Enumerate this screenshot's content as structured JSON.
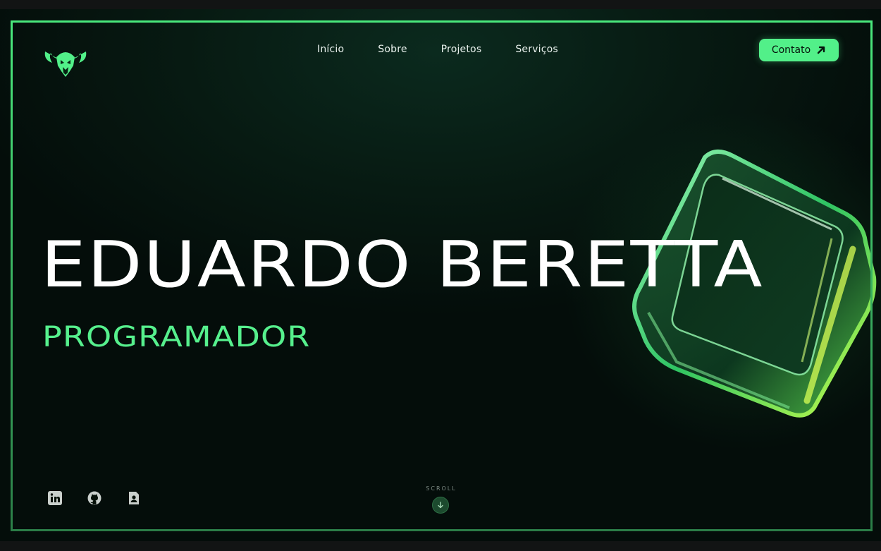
{
  "brand": {
    "logo_icon": "viking-helmet-icon"
  },
  "nav": {
    "items": [
      {
        "label": "Início"
      },
      {
        "label": "Sobre"
      },
      {
        "label": "Projetos"
      },
      {
        "label": "Serviços"
      }
    ],
    "contact_label": "Contato",
    "contact_icon": "arrow-up-right-icon"
  },
  "hero": {
    "name": "EDUARDO BERETTA",
    "role": "PROGRAMADOR"
  },
  "socials": [
    {
      "icon": "linkedin-icon"
    },
    {
      "icon": "github-icon"
    },
    {
      "icon": "resume-icon"
    }
  ],
  "scroll": {
    "label": "SCROLL",
    "icon": "arrow-down-icon"
  },
  "colors": {
    "accent": "#52f089",
    "background": "#040d0a",
    "text": "#ffffff"
  }
}
